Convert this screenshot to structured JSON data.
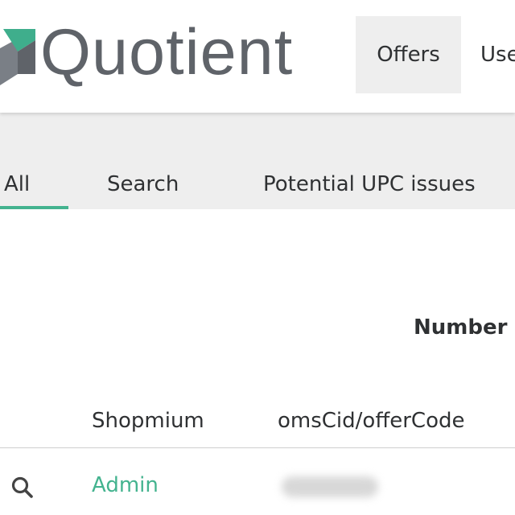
{
  "header": {
    "logo_text": "Quotient",
    "nav": [
      {
        "label": "Offers"
      },
      {
        "label": "Use"
      }
    ],
    "colors": {
      "logo_mark_green": "#3fae8c",
      "logo_mark_grey": "#6b7077",
      "logo_text": "#5f6369"
    }
  },
  "tabs": [
    {
      "label": "All",
      "active": true
    },
    {
      "label": "Search",
      "active": false
    },
    {
      "label": "Potential UPC issues",
      "active": false
    }
  ],
  "content": {
    "heading": "Number o",
    "table": {
      "columns": [
        "Shopmium",
        "omsCid/offerCode"
      ],
      "rows": [
        {
          "icon": "search-icon",
          "shopmium": "Admin",
          "oms_code": ""
        }
      ]
    }
  },
  "accent_color": "#44b38f"
}
